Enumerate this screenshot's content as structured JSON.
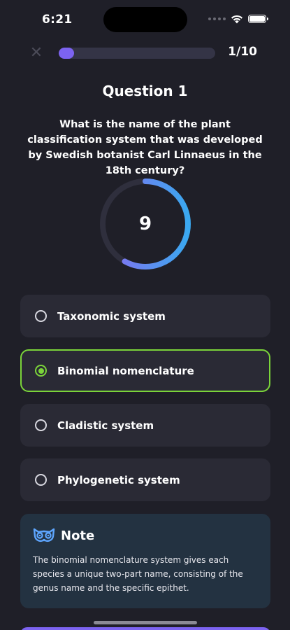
{
  "status_bar": {
    "time": "6:21"
  },
  "header": {
    "close_icon": "close-icon",
    "progress_fraction": 0.1,
    "progress_text": "1/10"
  },
  "question": {
    "title": "Question 1",
    "text": "What is the name of the plant classification system that was developed by Swedish botanist Carl Linnaeus in the 18th century?"
  },
  "timer": {
    "value": "9",
    "remaining_fraction": 0.58
  },
  "options": [
    {
      "label": "Taxonomic system",
      "selected": false
    },
    {
      "label": "Binomial nomenclature",
      "selected": true
    },
    {
      "label": "Cladistic system",
      "selected": false
    },
    {
      "label": "Phylogenetic system",
      "selected": false
    }
  ],
  "note": {
    "icon": "owl-icon",
    "title": "Note",
    "text": "The binomial nomenclature system gives each species a unique two-part name, consisting of the genus name and the specific epithet."
  },
  "colors": {
    "background": "#1f1f28",
    "accent_purple": "#7c63f0",
    "selected_green": "#7bd43a",
    "timer_gradient_start": "#8a6cf0",
    "timer_gradient_end": "#3aa8f0",
    "note_bg": "#233241"
  }
}
